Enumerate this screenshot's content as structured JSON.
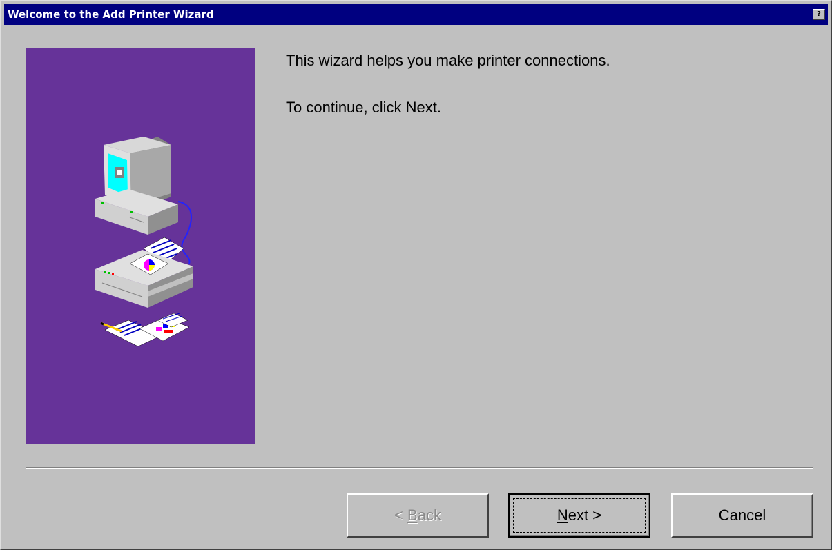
{
  "window": {
    "title": "Welcome to the Add Printer Wizard",
    "help_label": "?"
  },
  "content": {
    "line1": "This wizard helps you make printer connections.",
    "line2": "To continue, click Next."
  },
  "buttons": {
    "back": {
      "prefix": "< ",
      "mnemonic": "B",
      "rest": "ack",
      "enabled": false
    },
    "next": {
      "mnemonic": "N",
      "rest": "ext >",
      "enabled": true,
      "default": true
    },
    "cancel": {
      "label": "Cancel",
      "enabled": true
    }
  },
  "colors": {
    "titlebar": "#000080",
    "panel": "#663399",
    "face": "#c0c0c0"
  },
  "icons": [
    "help-icon",
    "computer-icon",
    "printer-icon",
    "documents-icon"
  ]
}
